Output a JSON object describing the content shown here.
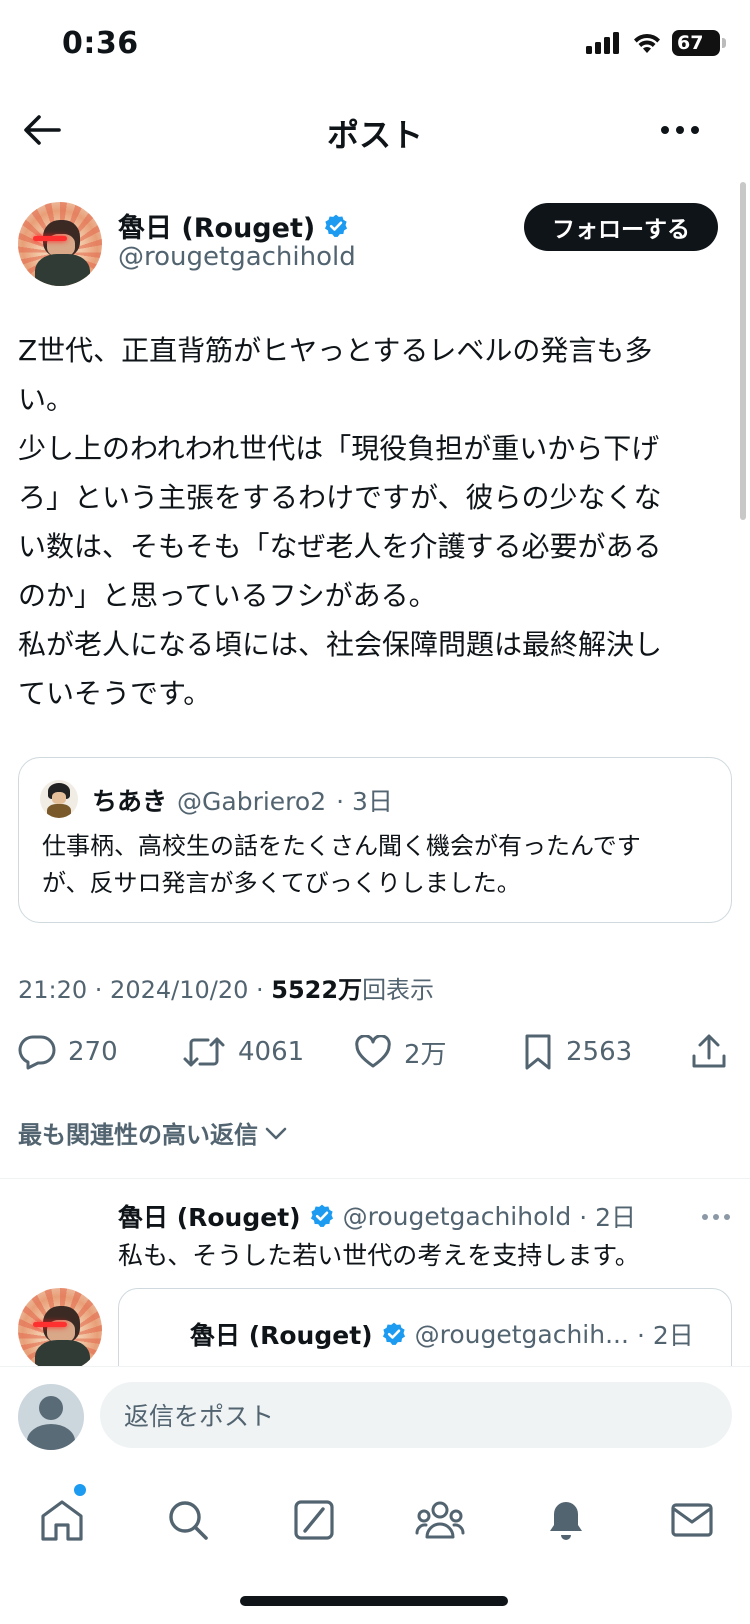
{
  "status_bar": {
    "time": "0:36",
    "battery": "67"
  },
  "header": {
    "title": "ポスト"
  },
  "post": {
    "author_name": "魯日 (Rouget)",
    "author_handle": "@rougetgachihold",
    "follow_label": "フォローする",
    "body_lines": [
      "Z世代、正直背筋がヒヤっとするレベルの発言も多",
      "い。",
      "少し上のわれわれ世代は「現役負担が重いから下げ",
      "ろ」という主張をするわけですが、彼らの少なくな",
      "い数は、そもそも「なぜ老人を介護する必要がある",
      "のか」と思っているフシがある。",
      "私が老人になる頃には、社会保障問題は最終解決し",
      "ていそうです。"
    ],
    "quote": {
      "name": "ちあき",
      "handle": "@Gabriero2",
      "age": "· 3日",
      "text_line1": "仕事柄、高校生の話をたくさん聞く機会が有ったんです",
      "text_line2": "が、反サロ発言が多くてびっくりしました。"
    },
    "timestamp": "21:20 · 2024/10/20 · ",
    "views_count": "5522万",
    "views_label": "回表示",
    "stats": {
      "replies": "270",
      "reposts": "4061",
      "likes": "2万",
      "bookmarks": "2563"
    }
  },
  "replies_sort_label": "最も関連性の高い返信",
  "reply": {
    "author_name": "魯日 (Rouget)",
    "author_handle": "@rougetgachihold",
    "age": "· 2日",
    "text": "私も、そうした若い世代の考えを支持します。",
    "nested": {
      "author_name": "魯日 (Rouget)",
      "author_handle": "@rougetgachih...",
      "age": "· 2日"
    }
  },
  "compose": {
    "placeholder": "返信をポスト"
  },
  "icons": {
    "back": "back-arrow-icon",
    "more": "more-horizontal-icon",
    "verified": "verified-badge-icon",
    "reply": "reply-icon",
    "repost": "repost-icon",
    "like": "heart-icon",
    "bookmark": "bookmark-icon",
    "share": "share-icon",
    "chevron": "chevron-down-icon",
    "home": "home-icon",
    "search": "search-icon",
    "grok": "grok-icon",
    "communities": "communities-icon",
    "notifications": "bell-icon",
    "messages": "mail-icon"
  },
  "colors": {
    "accent": "#1d9bf0",
    "text": "#0f1419",
    "muted": "#536471",
    "border": "#cfd9de"
  }
}
